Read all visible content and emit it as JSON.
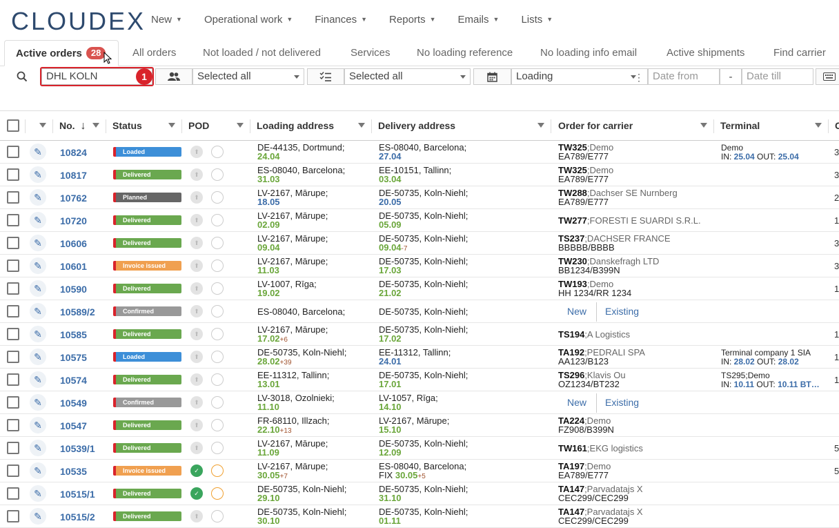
{
  "app": {
    "logo": "CLOUDEX"
  },
  "menu": [
    {
      "label": "New"
    },
    {
      "label": "Operational work"
    },
    {
      "label": "Finances"
    },
    {
      "label": "Reports"
    },
    {
      "label": "Emails"
    },
    {
      "label": "Lists"
    }
  ],
  "tabs": {
    "active": {
      "label": "Active orders",
      "count": "28"
    },
    "others": [
      "All orders",
      "Not loaded / not delivered",
      "Services",
      "No loading reference",
      "No loading info email",
      "Active shipments",
      "Find carrier"
    ]
  },
  "filters": {
    "search_value": "DHL KOLN",
    "marker": "1",
    "users_value": "Selected all",
    "status_value": "Selected all",
    "date_type": "Loading",
    "date_from_placeholder": "Date from",
    "date_sep": "-",
    "date_till_placeholder": "Date till"
  },
  "table": {
    "headers": {
      "no": "No.",
      "status": "Status",
      "pod": "POD",
      "loading": "Loading address",
      "delivery": "Delivery address",
      "order": "Order for carrier",
      "terminal": "Terminal",
      "last": "C"
    },
    "new_label": "New",
    "existing_label": "Existing",
    "rows": [
      {
        "no": "10824",
        "status": "Loaded",
        "st_color": "#3d8fd8",
        "pod": "none",
        "la": "DE-44135, Dortmund;",
        "ld": "24.04",
        "lx": "",
        "da": "ES-08040, Barcelona;",
        "dd": "27.04",
        "dx": "",
        "dblue": true,
        "ca": "TW325",
        "cb": ";Demo",
        "cc": "EA789/E777",
        "t1": "Demo",
        "tin": "25.04",
        "tout": "25.04",
        "last": "3"
      },
      {
        "no": "10817",
        "status": "Delivered",
        "st_color": "#6aa84f",
        "pod": "none",
        "la": "ES-08040, Barcelona;",
        "ld": "31.03",
        "lx": "",
        "da": "EE-10151, Tallinn;",
        "dd": "03.04",
        "dx": "",
        "ca": "TW325",
        "cb": ";Demo",
        "cc": "EA789/E777",
        "last": "3"
      },
      {
        "no": "10762",
        "status": "Planned",
        "st_color": "#666666",
        "pod": "none",
        "la": "LV-2167, Mārupe;",
        "ld": "18.05",
        "lblue": true,
        "lx": "",
        "da": "DE-50735, Koln-Niehl;",
        "dd": "20.05",
        "dblue": true,
        "dx": "",
        "ca": "TW288",
        "cb": ";Dachser SE Nurnberg",
        "cc": "EA789/E777",
        "last": "2"
      },
      {
        "no": "10720",
        "status": "Delivered",
        "st_color": "#6aa84f",
        "pod": "none",
        "la": "LV-2167, Mārupe;",
        "ld": "02.09",
        "lx": "",
        "da": "DE-50735, Koln-Niehl;",
        "dd": "05.09",
        "dx": "",
        "ca": "TW277",
        "cb": ";FORESTI E SUARDI S.R.L.",
        "cc": "",
        "last": "1"
      },
      {
        "no": "10606",
        "status": "Delivered",
        "st_color": "#6aa84f",
        "pod": "none",
        "la": "LV-2167, Mārupe;",
        "ld": "09.04",
        "lx": "",
        "da": "DE-50735, Koln-Niehl;",
        "dd": "09.04",
        "dx": "-7",
        "ca": "TS237",
        "cb": ";DACHSER FRANCE",
        "cc": "BBBBB/BBBB",
        "last": "3"
      },
      {
        "no": "10601",
        "status": "Invoice issued",
        "st_color": "#f0a050",
        "pod": "none",
        "la": "LV-2167, Mārupe;",
        "ld": "11.03",
        "lx": "",
        "da": "DE-50735, Koln-Niehl;",
        "dd": "17.03",
        "dx": "",
        "ca": "TW230",
        "cb": ";Danskefragh LTD",
        "cc": "BB1234/B399N",
        "last": "3"
      },
      {
        "no": "10590",
        "status": "Delivered",
        "st_color": "#6aa84f",
        "pod": "none",
        "la": "LV-1007, Rīga;",
        "ld": "19.02",
        "lx": "",
        "da": "DE-50735, Koln-Niehl;",
        "dd": "21.02",
        "dx": "",
        "ca": "TW193",
        "cb": ";Demo",
        "cc": "HH 1234/RR 1234",
        "last": "1"
      },
      {
        "no": "10589/2",
        "status": "Confirmed",
        "st_color": "#999999",
        "pod": "none",
        "la": "ES-08040, Barcelona;",
        "ld": "",
        "lx": "",
        "da": "DE-50735, Koln-Niehl;",
        "dd": "",
        "dx": "",
        "newexist": true,
        "last": ""
      },
      {
        "no": "10585",
        "status": "Delivered",
        "st_color": "#6aa84f",
        "pod": "none",
        "la": "LV-2167, Mārupe;",
        "ld": "17.02",
        "lx": "+6",
        "da": "DE-50735, Koln-Niehl;",
        "dd": "17.02",
        "dx": "",
        "ca": "TS194",
        "cb": ";A Logistics",
        "cc": "",
        "last": "1"
      },
      {
        "no": "10575",
        "status": "Loaded",
        "st_color": "#3d8fd8",
        "pod": "none",
        "la": "DE-50735, Koln-Niehl;",
        "ld": "28.02",
        "lx": "+39",
        "da": "EE-11312, Tallinn;",
        "dd": "24.01",
        "dblue": true,
        "dx": "",
        "ca": "TA192",
        "cb": ";PEDRALI SPA",
        "cc": "AA123/B123",
        "t1": "Terminal company 1 SIA",
        "tin": "28.02",
        "tout": "28.02",
        "last": "1"
      },
      {
        "no": "10574",
        "status": "Delivered",
        "st_color": "#6aa84f",
        "pod": "none",
        "la": "EE-11312, Tallinn;",
        "ld": "13.01",
        "lx": "",
        "da": "DE-50735, Koln-Niehl;",
        "dd": "17.01",
        "dx": "",
        "ca": "TS296",
        "cb": ";Klavis Ou",
        "cc": "OZ1234/BT232",
        "t1": "TS295;Demo",
        "tin": "10.11",
        "tout": "10.11 BT…",
        "last": "1"
      },
      {
        "no": "10549",
        "status": "Confirmed",
        "st_color": "#999999",
        "pod": "none",
        "la": "LV-3018, Ozolnieki;",
        "ld": "11.10",
        "lx": "",
        "da": "LV-1057, Rīga;",
        "dd": "14.10",
        "dx": "",
        "newexist": true,
        "last": ""
      },
      {
        "no": "10547",
        "status": "Delivered",
        "st_color": "#6aa84f",
        "pod": "none",
        "la": "FR-68110, Illzach;",
        "ld": "22.10",
        "lx": "+13",
        "da": "LV-2167, Mārupe;",
        "dd": "15.10",
        "dx": "",
        "ca": "TA224",
        "cb": ";Demo",
        "cc": "FZ908/B399N",
        "last": ""
      },
      {
        "no": "10539/1",
        "status": "Delivered",
        "st_color": "#6aa84f",
        "pod": "none",
        "la": "LV-2167, Mārupe;",
        "ld": "11.09",
        "lx": "",
        "da": "DE-50735, Koln-Niehl;",
        "dd": "12.09",
        "dx": "",
        "ca": "TW161",
        "cb": ";EKG logistics",
        "cc": "",
        "last": "5"
      },
      {
        "no": "10535",
        "status": "Invoice issued",
        "st_color": "#f0a050",
        "pod": "ok",
        "la": "LV-2167, Mārupe;",
        "ld": "30.05",
        "lx": "+7",
        "da": "ES-08040, Barcelona;",
        "dd": "30.05",
        "dpre": "FIX ",
        "dx": "+5",
        "ca": "TA197",
        "cb": ";Demo",
        "cc": "EA789/E777",
        "last": "5"
      },
      {
        "no": "10515/1",
        "status": "Delivered",
        "st_color": "#6aa84f",
        "pod": "ok",
        "la": "DE-50735, Koln-Niehl;",
        "ld": "29.10",
        "lx": "",
        "da": "DE-50735, Koln-Niehl;",
        "dd": "31.10",
        "dx": "",
        "ca": "TA147",
        "cb": ";Parvadatajs X",
        "cc": "CEC299/CEC299",
        "last": ""
      },
      {
        "no": "10515/2",
        "status": "Delivered",
        "st_color": "#6aa84f",
        "pod": "none",
        "la": "DE-50735, Koln-Niehl;",
        "ld": "30.10",
        "lx": "",
        "da": "DE-50735, Koln-Niehl;",
        "dd": "01.11",
        "dx": "",
        "ca": "TA147",
        "cb": ";Parvadatajs X",
        "cc": "CEC299/CEC299",
        "last": ""
      }
    ]
  }
}
